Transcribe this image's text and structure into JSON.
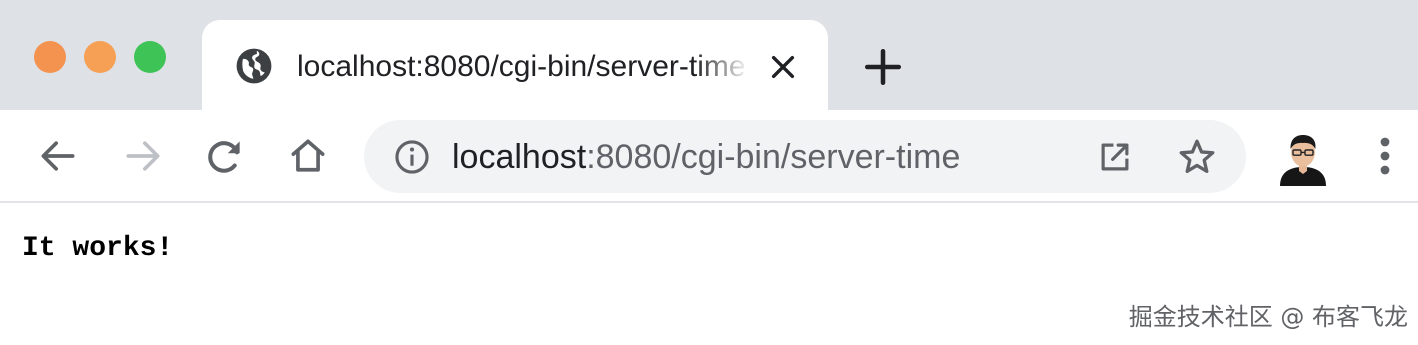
{
  "window": {
    "traffic_lights": {
      "close_color": "#f4934f",
      "minimize_color": "#f6a055",
      "maximize_color": "#3ec356"
    }
  },
  "tab": {
    "title": "localhost:8080/cgi-bin/server-time",
    "favicon": "globe-icon",
    "close_icon": "close-icon"
  },
  "new_tab_icon": "plus-icon",
  "toolbar": {
    "back_icon": "arrow-left-icon",
    "forward_icon": "arrow-right-icon",
    "reload_icon": "reload-icon",
    "home_icon": "home-icon",
    "menu_icon": "more-vertical-icon"
  },
  "address_bar": {
    "info_icon": "info-icon",
    "url_host": "localhost",
    "url_rest": ":8080/cgi-bin/server-time",
    "open_in_icon": "open-external-icon",
    "bookmark_icon": "star-icon"
  },
  "profile": {
    "avatar_icon": "profile-avatar-icon"
  },
  "page": {
    "body_text": "It works!"
  },
  "watermark": {
    "text": "掘金技术社区 @ 布客飞龙"
  },
  "colors": {
    "tabstrip_bg": "#dee1e6",
    "omnibox_bg": "#f1f3f4",
    "text_primary": "#202124",
    "text_secondary": "#5f6368"
  }
}
